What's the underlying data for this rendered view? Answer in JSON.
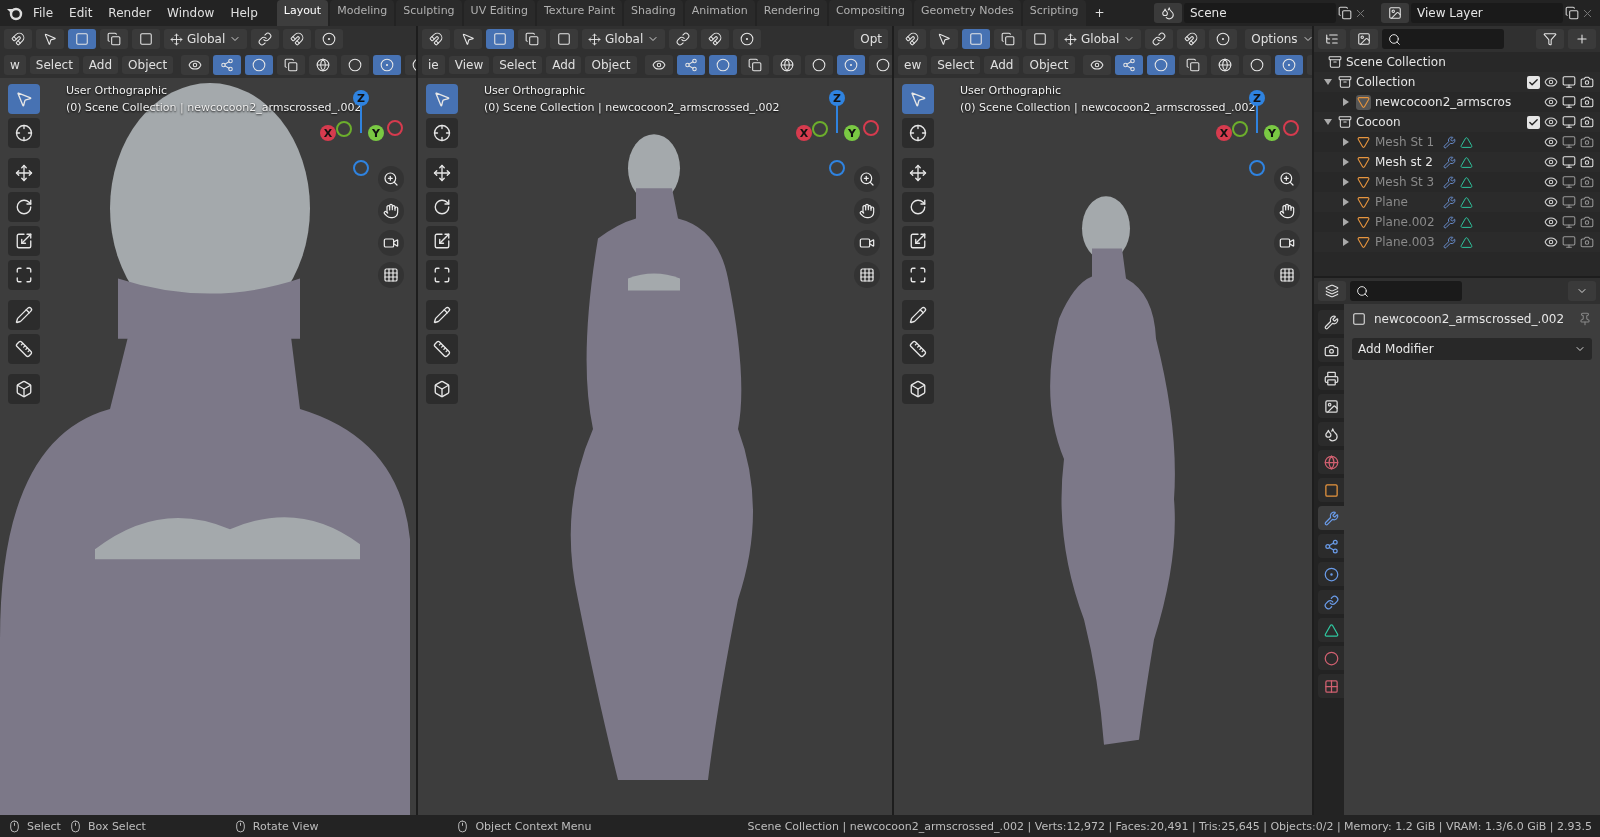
{
  "top_bar": {
    "menus": [
      "File",
      "Edit",
      "Render",
      "Window",
      "Help"
    ],
    "workspace_tabs": [
      {
        "label": "Layout",
        "selected": true
      },
      {
        "label": "Modeling",
        "selected": false
      },
      {
        "label": "Sculpting",
        "selected": false
      },
      {
        "label": "UV Editing",
        "selected": false
      },
      {
        "label": "Texture Paint",
        "selected": false
      },
      {
        "label": "Shading",
        "selected": false
      },
      {
        "label": "Animation",
        "selected": false
      },
      {
        "label": "Rendering",
        "selected": false
      },
      {
        "label": "Compositing",
        "selected": false
      },
      {
        "label": "Geometry Nodes",
        "selected": false
      },
      {
        "label": "Scripting",
        "selected": false
      }
    ],
    "add_tab": "+",
    "scene": "Scene",
    "view_layer": "View Layer"
  },
  "viewports": [
    {
      "orientation": "Global",
      "mode_cut": "w",
      "menus": [
        "Select",
        "Add",
        "Object"
      ],
      "overlay": [
        "User Orthographic",
        "(0) Scene Collection | newcocoon2_armscrossed_.002"
      ],
      "axes": {
        "x": "X",
        "y": "Y",
        "z": "Z"
      },
      "kind": "closeup"
    },
    {
      "orientation": "Global",
      "options": "Opt",
      "mode_cut": "ie",
      "menus": [
        "View",
        "Select",
        "Add",
        "Object"
      ],
      "overlay": [
        "User Orthographic",
        "(0) Scene Collection | newcocoon2_armscrossed_.002"
      ],
      "axes": {
        "x": "X",
        "y": "Y",
        "z": "Z"
      },
      "kind": "front"
    },
    {
      "orientation": "Global",
      "options": "Options",
      "mode_cut": "ew",
      "menus": [
        "Select",
        "Add",
        "Object"
      ],
      "overlay": [
        "User Orthographic",
        "(0) Scene Collection | newcocoon2_armscrossed_.002"
      ],
      "axes": {
        "x": "X",
        "y": "Y",
        "z": "Z"
      },
      "kind": "side"
    }
  ],
  "outliner": {
    "root": "Scene Collection",
    "children": [
      {
        "kind": "collection",
        "label": "Collection",
        "expanded": true,
        "checked": true,
        "children": [
          {
            "kind": "object",
            "label": "newcocoon2_armscros",
            "expanded": false,
            "dimmed": false,
            "selected": true,
            "modifiers": false
          }
        ]
      },
      {
        "kind": "collection",
        "label": "Cocoon",
        "expanded": true,
        "checked": true,
        "children": [
          {
            "kind": "object",
            "label": "Mesh St 1",
            "expanded": false,
            "dimmed": true,
            "selected": false,
            "modifiers": true
          },
          {
            "kind": "object",
            "label": "Mesh st 2",
            "expanded": false,
            "dimmed": false,
            "selected": false,
            "modifiers": true
          },
          {
            "kind": "object",
            "label": "Mesh St 3",
            "expanded": false,
            "dimmed": true,
            "selected": false,
            "modifiers": true
          },
          {
            "kind": "object",
            "label": "Plane",
            "expanded": false,
            "dimmed": true,
            "selected": false,
            "modifiers": true
          },
          {
            "kind": "object",
            "label": "Plane.002",
            "expanded": false,
            "dimmed": true,
            "selected": false,
            "modifiers": true
          },
          {
            "kind": "object",
            "label": "Plane.003",
            "expanded": false,
            "dimmed": true,
            "selected": false,
            "modifiers": true
          }
        ]
      }
    ]
  },
  "properties": {
    "object_name": "newcocoon2_armscrossed_.002",
    "add_modifier": "Add Modifier",
    "tabs": [
      {
        "kind": "tool",
        "selected": false
      },
      {
        "kind": "render",
        "selected": false
      },
      {
        "kind": "output",
        "selected": false
      },
      {
        "kind": "viewlayer",
        "selected": false
      },
      {
        "kind": "scene",
        "selected": false
      },
      {
        "kind": "world",
        "selected": false
      },
      {
        "kind": "object",
        "selected": false
      },
      {
        "kind": "modifier",
        "selected": true
      },
      {
        "kind": "particles",
        "selected": false
      },
      {
        "kind": "physics",
        "selected": false
      },
      {
        "kind": "constraints",
        "selected": false
      },
      {
        "kind": "data",
        "selected": false
      },
      {
        "kind": "material",
        "selected": false
      },
      {
        "kind": "texture",
        "selected": false
      }
    ]
  },
  "status_bar": {
    "hints": [
      {
        "kind": "left",
        "label": "Select"
      },
      {
        "kind": "drag",
        "label": "Box Select"
      },
      {
        "kind": "middle",
        "label": "Rotate View"
      },
      {
        "kind": "right",
        "label": "Object Context Menu"
      }
    ],
    "stats": "Scene Collection | newcocoon2_armscrossed_.002 | Verts:12,972 | Faces:20,491 | Tris:25,645 | Objects:0/2 | Memory: 1.2 GiB | VRAM: 1.3/6.0 GiB | 2.93.5"
  }
}
